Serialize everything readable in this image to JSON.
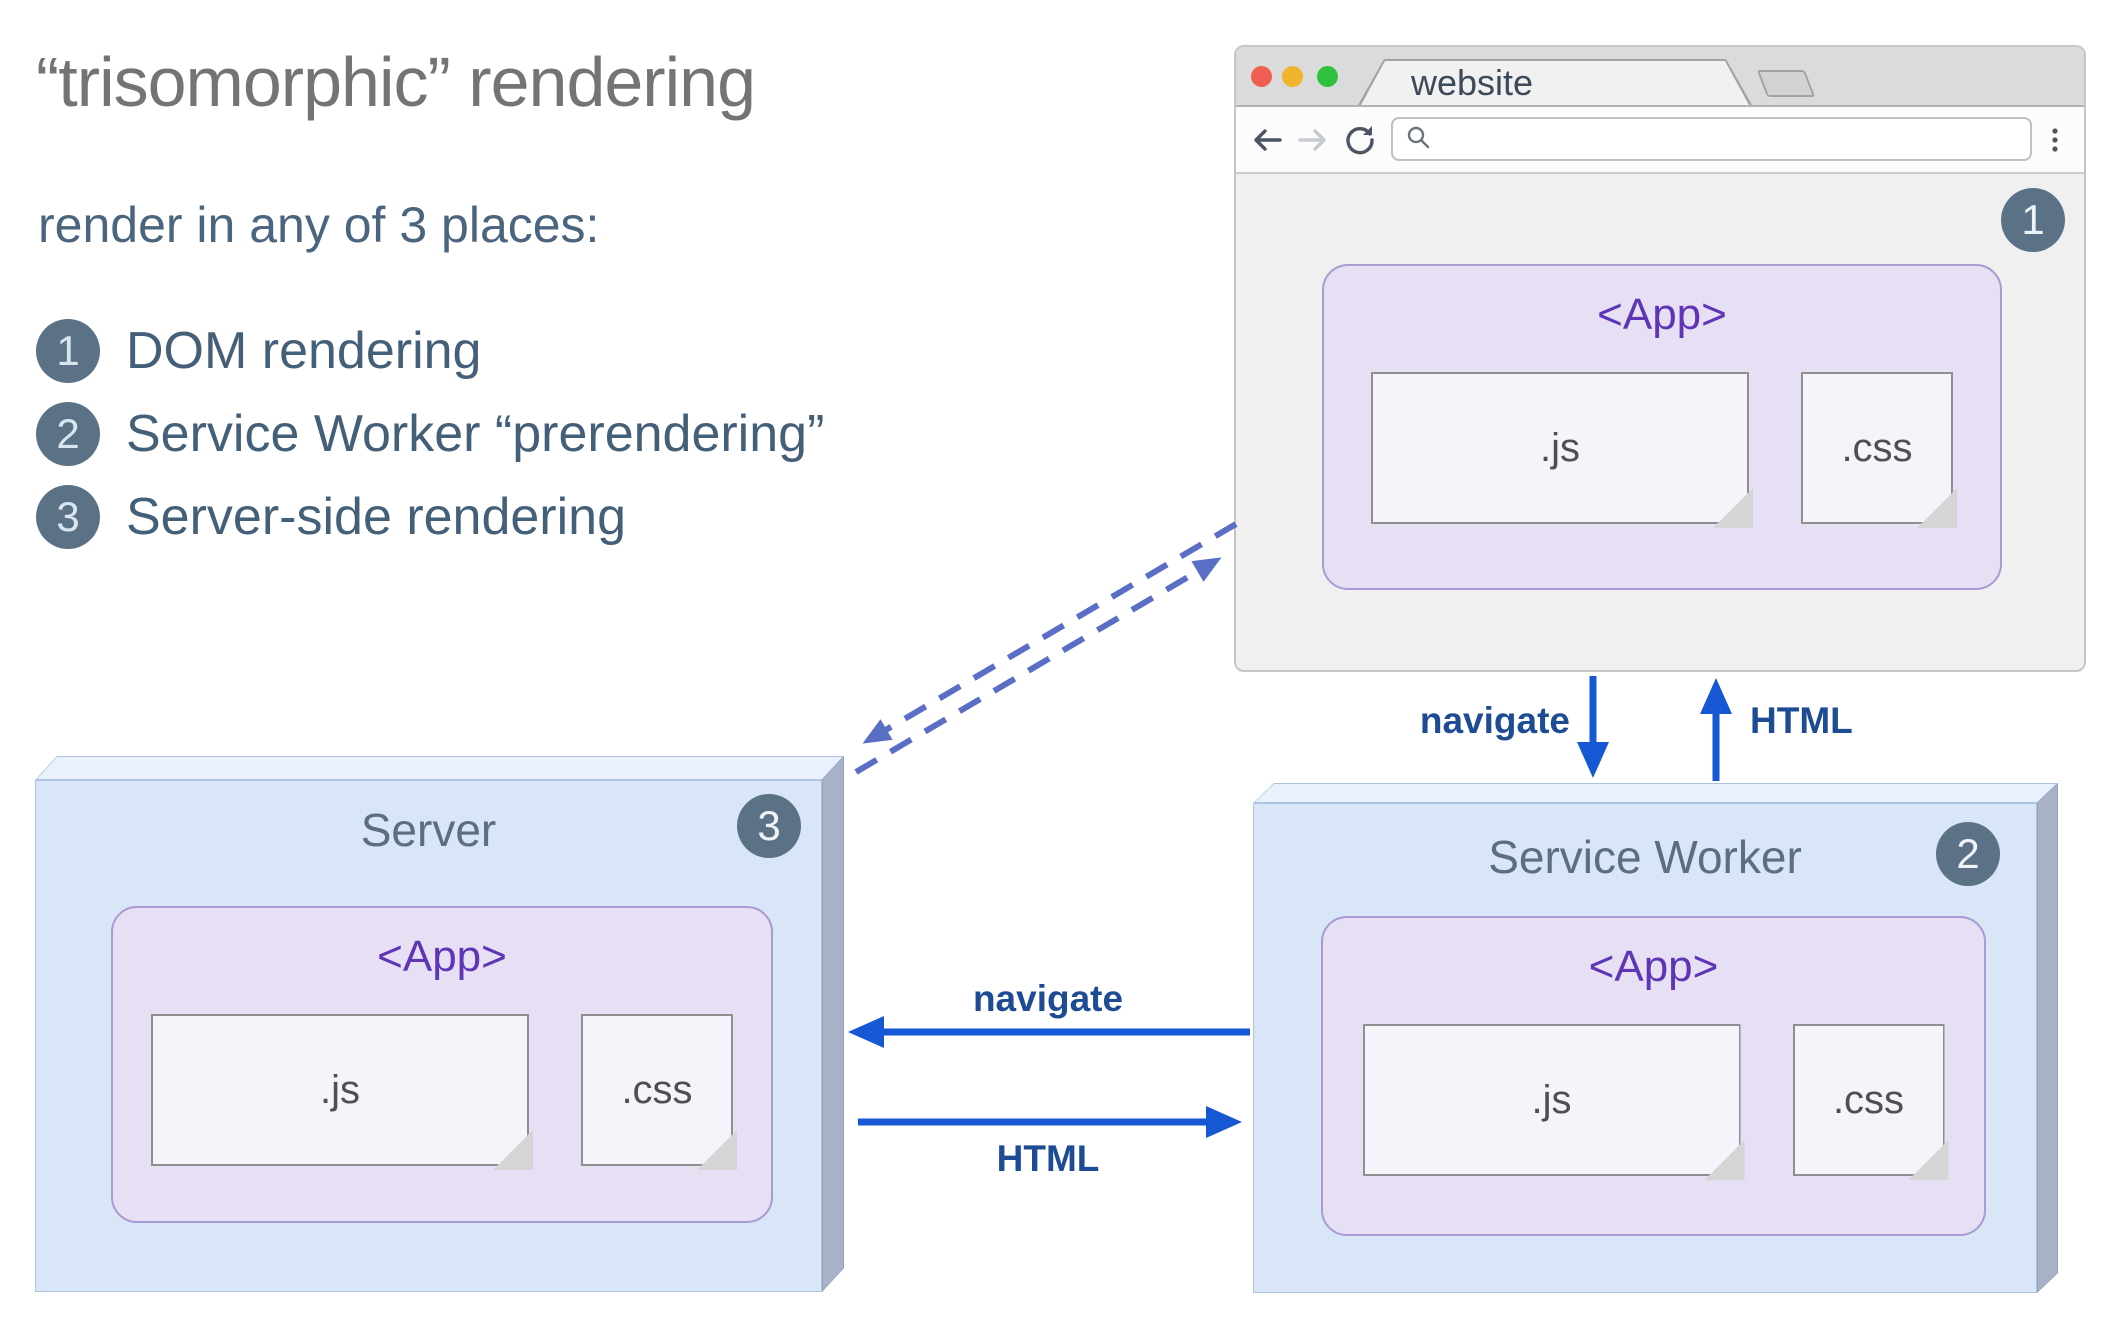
{
  "heading": {
    "title": "“trisomorphic” rendering",
    "subtitle": "render in any of 3 places:",
    "items": [
      {
        "num": "1",
        "label": "DOM rendering"
      },
      {
        "num": "2",
        "label": "Service Worker “prerendering”"
      },
      {
        "num": "3",
        "label": "Server-side rendering"
      }
    ]
  },
  "browser": {
    "tab_title": "website",
    "badge": "1",
    "url_value": "",
    "app": {
      "title": "<App>",
      "js": ".js",
      "css": ".css"
    }
  },
  "server": {
    "title": "Server",
    "badge": "3",
    "app": {
      "title": "<App>",
      "js": ".js",
      "css": ".css"
    }
  },
  "service_worker": {
    "title": "Service Worker",
    "badge": "2",
    "app": {
      "title": "<App>",
      "js": ".js",
      "css": ".css"
    }
  },
  "arrows": {
    "browser_to_sw": "navigate",
    "sw_to_browser": "HTML",
    "sw_to_server": "navigate",
    "server_to_sw": "HTML"
  },
  "colors": {
    "arrow_blue": "#1657d3",
    "dashed_blue": "#5b6ec6",
    "label_navy": "#1e4c94",
    "badge_bg": "#5b7286",
    "app_purple": "#5d35b5",
    "box_fill": "#d9e6f7",
    "app_fill": "#e7e0f5"
  }
}
